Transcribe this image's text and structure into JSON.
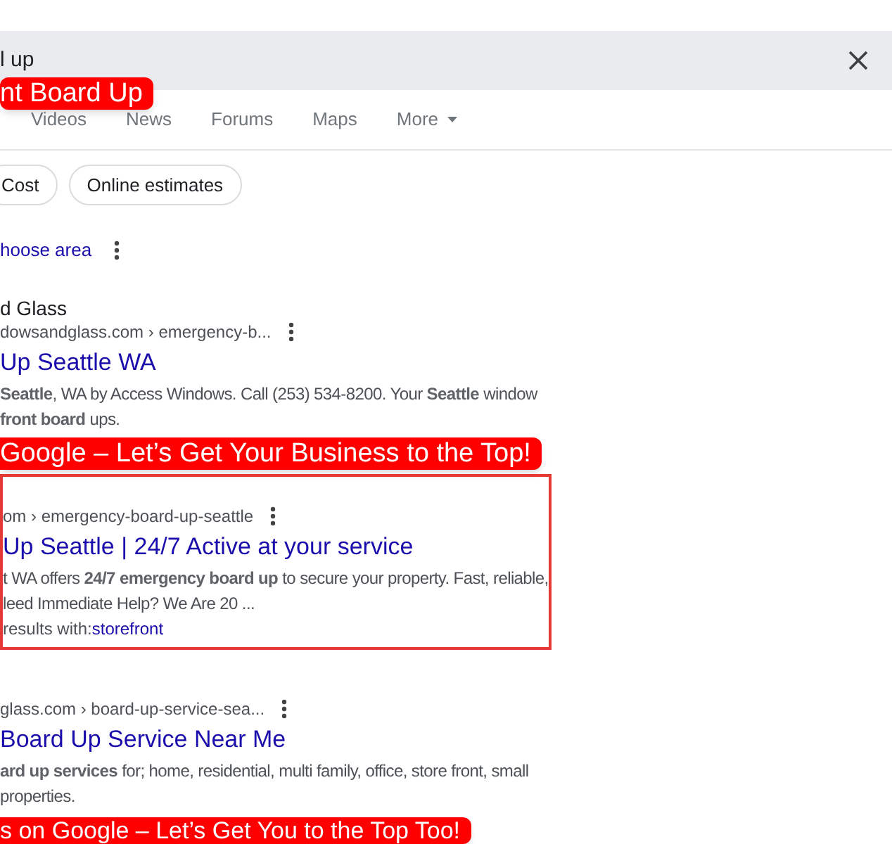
{
  "search": {
    "value": "l up"
  },
  "overlay_label": "nt Board Up",
  "tabs": [
    {
      "label": "Videos",
      "selected": false
    },
    {
      "label": "News",
      "selected": false
    },
    {
      "label": "Forums",
      "selected": false
    },
    {
      "label": "Maps",
      "selected": false
    },
    {
      "label": "More",
      "selected": false,
      "kind": "menu"
    }
  ],
  "chips": [
    "Cost",
    "Online estimates"
  ],
  "area_link": "hoose area",
  "results": [
    {
      "kind": "plain",
      "site": "d Glass",
      "url": "dowsandglass.com › emergency-b...",
      "title": "Up Seattle WA",
      "lines": [
        "**Seattle**, WA by Access Windows. Call (253) 534-8200. Your **Seattle** window",
        "**front board** ups."
      ],
      "banner_after": "Google – Let’s Get Your Business to the Top!"
    },
    {
      "kind": "highlighted",
      "url": "om › emergency-board-up-seattle",
      "title": "Up Seattle | 24/7 Active at your service",
      "lines": [
        "t WA offers **24/7 emergency board up** to secure your property. Fast, reliable,",
        "leed Immediate Help? We Are 20 ..."
      ],
      "more_prefix": "results with: ",
      "more_link": "storefront"
    },
    {
      "kind": "plain",
      "url": "glass.com › board-up-service-sea...",
      "title": "Board Up Service Near Me",
      "lines": [
        "**ard up services** for; home, residential, multi family, office, store front, small",
        "properties."
      ]
    }
  ],
  "bottom_banner": "s on Google – Let’s Get You to the Top Too!"
}
